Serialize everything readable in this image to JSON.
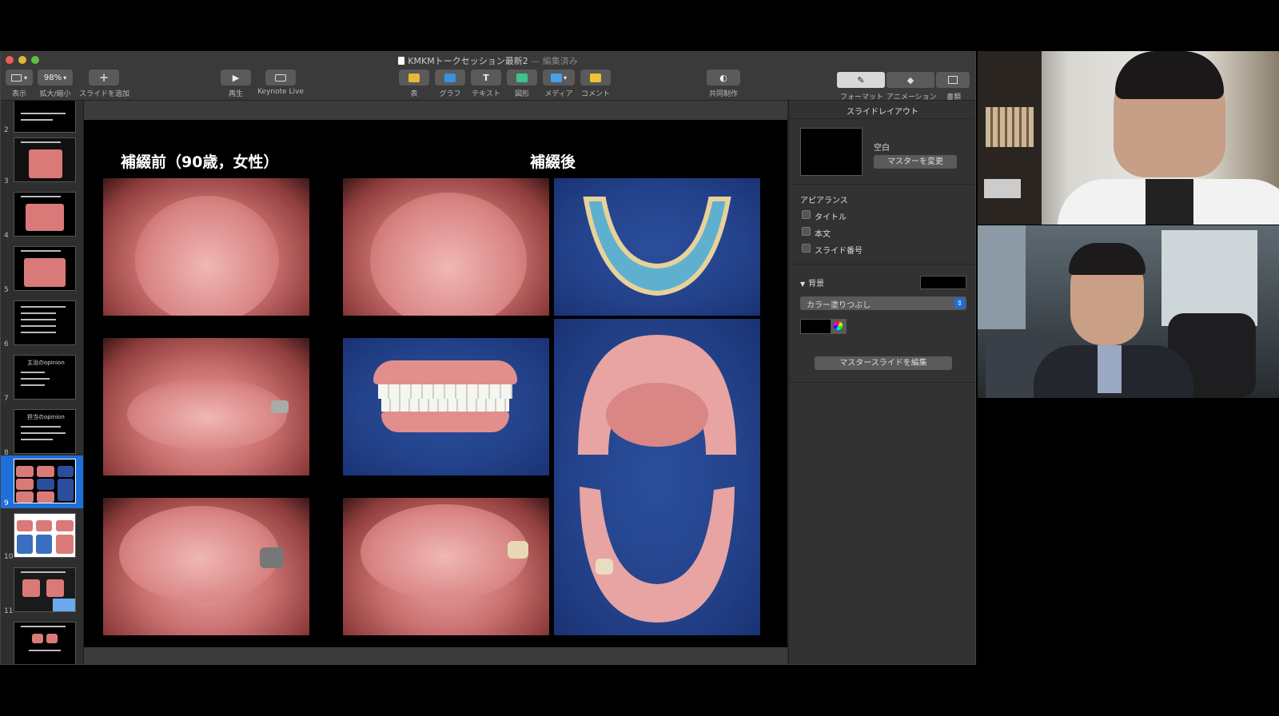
{
  "window": {
    "title": "KMKMトークセッション最新2",
    "edited": "— 編集済み"
  },
  "toolbar": {
    "view_label": "表示",
    "zoom_value": "98%",
    "zoom_label": "拡大/縮小",
    "add_slide_label": "スライドを追加",
    "play_label": "再生",
    "keynote_live_label": "Keynote Live",
    "table_label": "表",
    "chart_label": "グラフ",
    "text_label": "テキスト",
    "shape_label": "図形",
    "media_label": "メディア",
    "comment_label": "コメント",
    "collaborate_label": "共同制作",
    "format_label": "フォーマット",
    "animate_label": "アニメーション",
    "document_label": "書類"
  },
  "navigator": {
    "slide_numbers": [
      "2",
      "3",
      "4",
      "5",
      "6",
      "7",
      "8",
      "9",
      "10",
      "11"
    ],
    "selected": "9",
    "thumb_texts": {
      "7": "主治のopinion",
      "8": "担当のopinion"
    }
  },
  "slide": {
    "heading_before": "補綴前（90歳，女性）",
    "heading_after": "補綴後"
  },
  "inspector": {
    "header": "スライドレイアウト",
    "master_name": "空白",
    "change_master_button": "マスターを変更",
    "appearance_label": "アピアランス",
    "checkbox_title": "タイトル",
    "checkbox_body": "本文",
    "checkbox_slide_number": "スライド番号",
    "background_label": "背景",
    "fill_type": "カラー塗りつぶし",
    "edit_master_button": "マスタースライドを編集"
  },
  "colors": {
    "accent_blue": "#1e6fd9",
    "window_bg": "#2b2b2b",
    "photo_blue": "#23428a",
    "gum_pink": "#d98685"
  }
}
